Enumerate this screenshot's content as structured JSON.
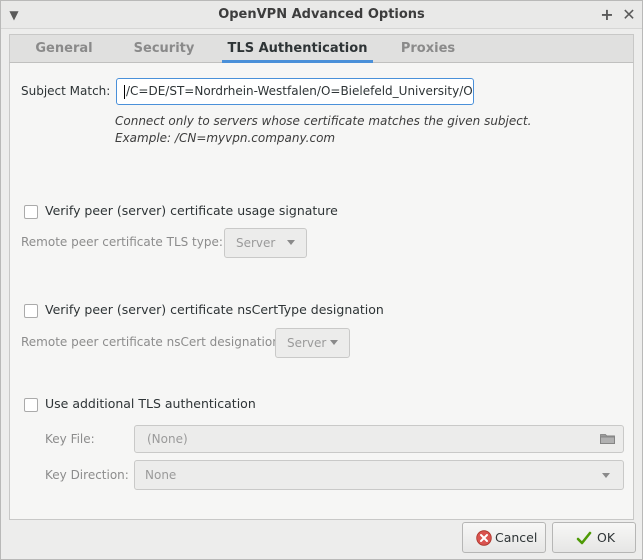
{
  "window": {
    "title": "OpenVPN Advanced Options"
  },
  "tabs": [
    {
      "label": "General"
    },
    {
      "label": "Security"
    },
    {
      "label": "TLS Authentication"
    },
    {
      "label": "Proxies"
    }
  ],
  "subject_match": {
    "label": "Subject Match:",
    "value": "/C=DE/ST=Nordrhein-Westfalen/O=Bielefeld_University/OU=D",
    "hint_line1": "Connect only to servers whose certificate matches the given subject.",
    "hint_line2": "Example: /CN=myvpn.company.com"
  },
  "verify_usage": {
    "checkbox_label": "Verify peer (server) certificate usage signature",
    "checked": false,
    "tls_type_label": "Remote peer certificate TLS type:",
    "tls_type_value": "Server"
  },
  "verify_nscert": {
    "checkbox_label": "Verify peer (server) certificate nsCertType designation",
    "checked": false,
    "nscert_label": "Remote peer certificate nsCert designation:",
    "nscert_value": "Server"
  },
  "tls_auth": {
    "checkbox_label": "Use additional TLS authentication",
    "checked": false,
    "key_file_label": "Key File:",
    "key_file_value": "(None)",
    "key_direction_label": "Key Direction:",
    "key_direction_value": "None"
  },
  "buttons": {
    "cancel_label": "Cancel",
    "ok_label": "OK"
  },
  "colors": {
    "accent": "#4a90d9",
    "cancel_icon": "#d9534f",
    "ok_icon": "#4e9a06"
  }
}
